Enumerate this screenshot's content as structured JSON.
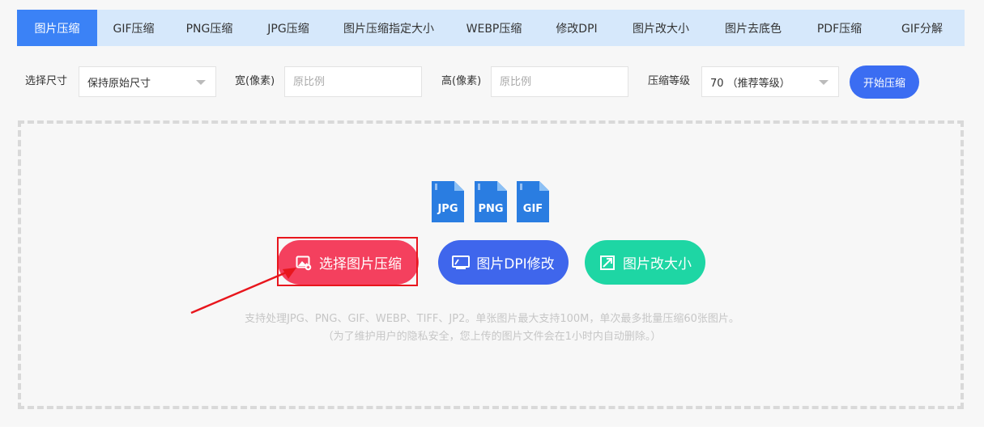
{
  "tabs": [
    {
      "label": "图片压缩",
      "active": true
    },
    {
      "label": "GIF压缩"
    },
    {
      "label": "PNG压缩"
    },
    {
      "label": "JPG压缩"
    },
    {
      "label": "图片压缩指定大小"
    },
    {
      "label": "WEBP压缩"
    },
    {
      "label": "修改DPI"
    },
    {
      "label": "图片改大小"
    },
    {
      "label": "图片去底色"
    },
    {
      "label": "PDF压缩"
    },
    {
      "label": "GIF分解"
    }
  ],
  "settings": {
    "size_label": "选择尺寸",
    "size_value": "保持原始尺寸",
    "width_label": "宽(像素)",
    "width_placeholder": "原比例",
    "height_label": "高(像素)",
    "height_placeholder": "原比例",
    "level_label": "压缩等级",
    "level_value": "70 （推荐等级）",
    "start_label": "开始压缩"
  },
  "formats": [
    "JPG",
    "PNG",
    "GIF"
  ],
  "actions": {
    "select_label": "选择图片压缩",
    "dpi_label": "图片DPI修改",
    "resize_label": "图片改大小"
  },
  "hints": {
    "line1": "支持处理JPG、PNG、GIF、WEBP、TIFF、JP2。单张图片最大支持100M，单次最多批量压缩60张图片。",
    "line2": "（为了维护用户的隐私安全，您上传的图片文件会在1小时内自动删除。）"
  },
  "colors": {
    "accent": "#3b82f6",
    "tab_bar": "#d6e8fb",
    "select_button": "#f4405e",
    "dpi_button": "#3f66ec",
    "resize_button": "#1ed6a4",
    "highlight": "#e8161d",
    "file_icon": "#2a7de1"
  }
}
